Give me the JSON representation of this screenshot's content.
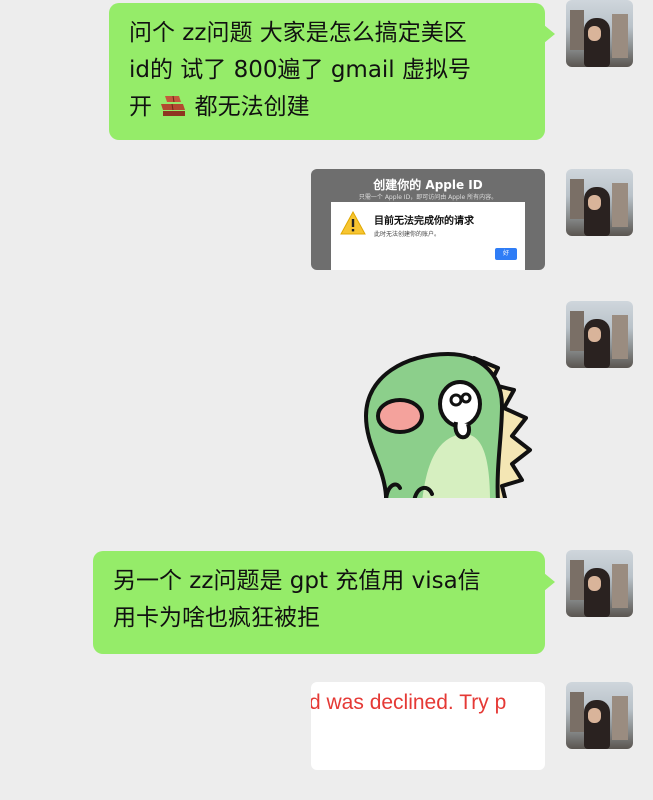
{
  "messages": [
    {
      "type": "text",
      "lines": [
        "问个 zz问题 大家是怎么搞定美区",
        "id的 试了 800遍了 gmail 虚拟号",
        "开 🧱 都无法创建"
      ],
      "icon": "brick-emoji"
    },
    {
      "type": "image",
      "screenshot": {
        "title": "创建你的 Apple ID",
        "subtitle": "只需一个 Apple ID，即可访问由 Apple 所有内容。",
        "dialog_title": "目前无法完成你的请求",
        "dialog_message": "此时无法创建你的账户。",
        "ok_label": "好",
        "icon": "warning-icon"
      }
    },
    {
      "type": "sticker",
      "name": "crying-green-dinosaur-sticker"
    },
    {
      "type": "text",
      "lines": [
        "另一个 zz问题是 gpt 充值用 visa信",
        "用卡为啥也疯狂被拒"
      ]
    },
    {
      "type": "image",
      "screenshot": {
        "error_text": "d was declined. Try p"
      }
    }
  ],
  "colors": {
    "background": "#ededed",
    "bubble": "#95ec69",
    "error": "#e53935",
    "ok_button": "#2f7df6"
  }
}
